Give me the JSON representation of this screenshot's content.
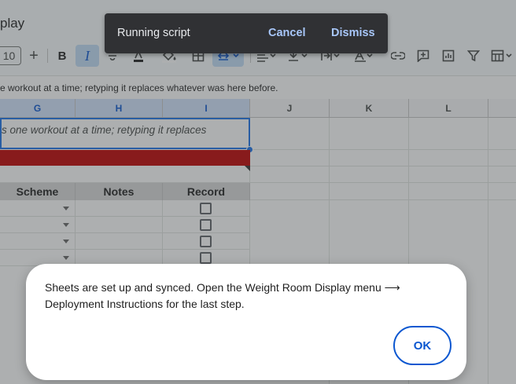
{
  "app": {
    "title_partial": "play"
  },
  "toolbar": {
    "font_size": "10",
    "plus": "+",
    "bold": "B",
    "italic": "I"
  },
  "formula_bar": {
    "text": "e workout at a time; retyping it replaces whatever was here before."
  },
  "grid": {
    "columns": [
      "G",
      "H",
      "I",
      "J",
      "K",
      "L"
    ],
    "note_text": "s one workout at a time; retyping it replaces",
    "headers": [
      "Scheme",
      "Notes",
      "Record"
    ]
  },
  "toast": {
    "message": "Running script",
    "cancel_label": "Cancel",
    "dismiss_label": "Dismiss"
  },
  "dialog": {
    "message": "Sheets are set up and synced. Open the Weight Room Display menu ⟶ Deployment Instructions for the last step.",
    "ok_label": "OK"
  },
  "colors": {
    "accent": "#0b57d0",
    "toast_bg": "#303134",
    "band": "#c00000",
    "selection": "#1a73e8"
  }
}
